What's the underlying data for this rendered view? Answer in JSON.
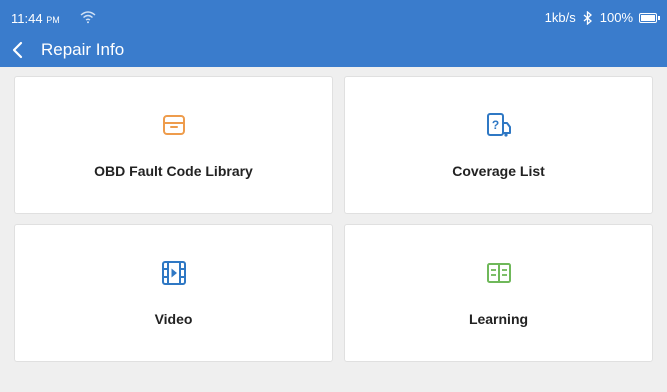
{
  "status": {
    "time": "11:44",
    "ampm": "PM",
    "network_speed": "1kb/s",
    "battery": "100%",
    "icons": [
      "wifi-icon",
      "bluetooth-icon",
      "battery-icon"
    ]
  },
  "header": {
    "title": "Repair Info",
    "back_icon": "back-arrow-icon"
  },
  "colors": {
    "header_bg": "#3a7ccc",
    "page_bg": "#efefef",
    "obd_icon": "#ee9c4c",
    "coverage_icon": "#2f78c4",
    "video_icon": "#2f78c4",
    "learning_icon": "#6fb85a"
  },
  "menu": {
    "items": [
      {
        "label": "OBD Fault Code Library",
        "icon": "archive-box-icon"
      },
      {
        "label": "Coverage List",
        "icon": "question-vehicle-icon"
      },
      {
        "label": "Video",
        "icon": "film-play-icon"
      },
      {
        "label": "Learning",
        "icon": "open-book-icon"
      }
    ]
  }
}
